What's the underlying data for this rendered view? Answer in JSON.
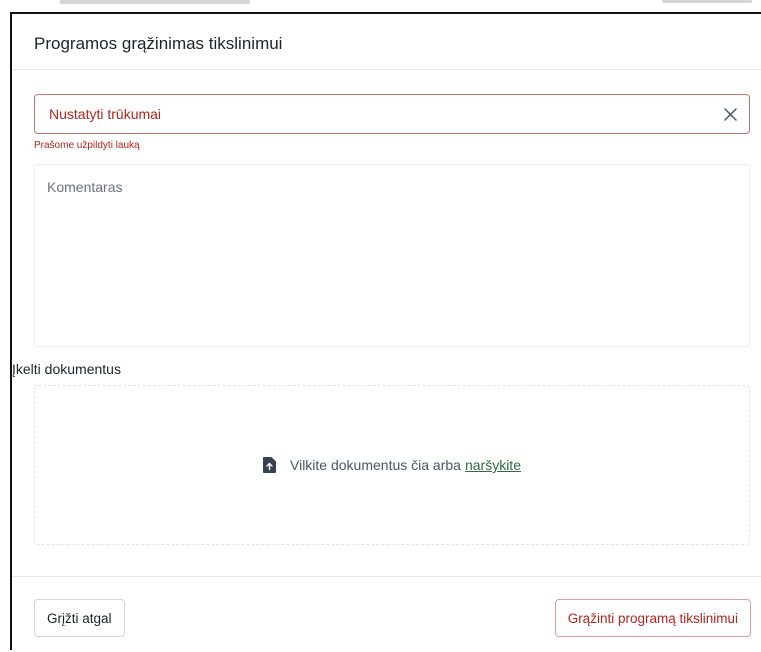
{
  "modal": {
    "title": "Programos grąžinimas tikslinimui"
  },
  "deficiencies_field": {
    "placeholder": "Nustatyti trūkumai",
    "value": "",
    "error": "Prašome užpildyti lauką",
    "clear_icon": "close-icon"
  },
  "comment_field": {
    "placeholder": "Komentaras",
    "value": ""
  },
  "upload": {
    "label": "Įkelti dokumentus",
    "drop_text": "Vilkite dokumentus čia arba",
    "browse_link": "naršykite",
    "icon": "file-upload-icon"
  },
  "footer": {
    "back_label": "Grįžti atgal",
    "return_label": "Grąžinti programą tikslinimui"
  },
  "colors": {
    "error": "#b3261e",
    "error_border": "#c9756d",
    "link": "#2e6b3f"
  }
}
